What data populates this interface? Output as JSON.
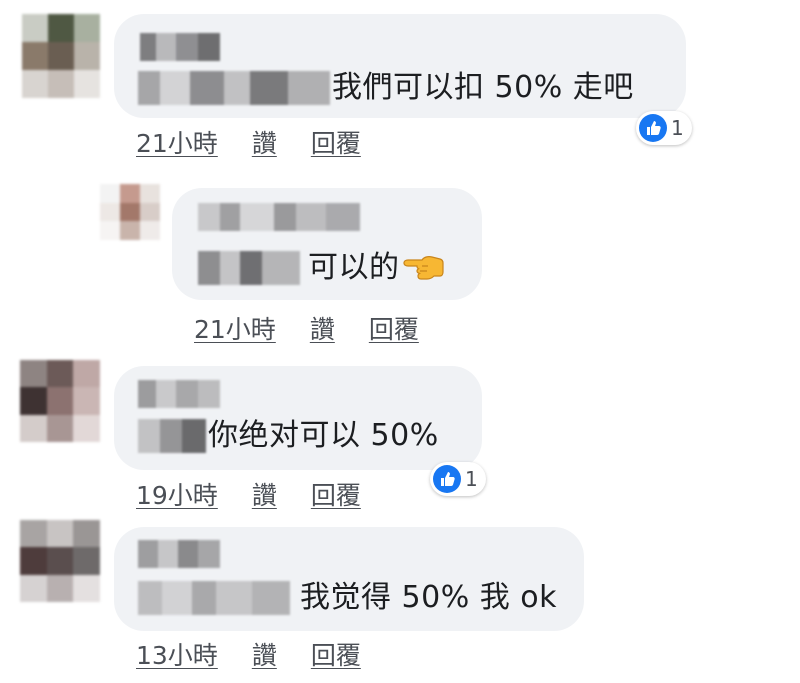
{
  "comments": [
    {
      "message": "我們可以扣 50% 走吧",
      "time": "21小時",
      "like_label": "讚",
      "reply_label": "回覆",
      "reaction_count": "1"
    },
    {
      "message": "可以的",
      "time": "21小時",
      "like_label": "讚",
      "reply_label": "回覆"
    },
    {
      "message": "你绝对可以 50%",
      "time": "19小時",
      "like_label": "讚",
      "reply_label": "回覆",
      "reaction_count": "1"
    },
    {
      "message": "我觉得 50% 我 ok",
      "time": "13小時",
      "like_label": "讚",
      "reply_label": "回覆"
    }
  ],
  "colors": {
    "bubble": "#f0f2f5",
    "action_text": "#4b4f56",
    "like_blue": "#1877f2"
  },
  "icons": {
    "reaction": "thumbs-up-icon",
    "emoji": "backhand-index-pointing-left-icon"
  }
}
